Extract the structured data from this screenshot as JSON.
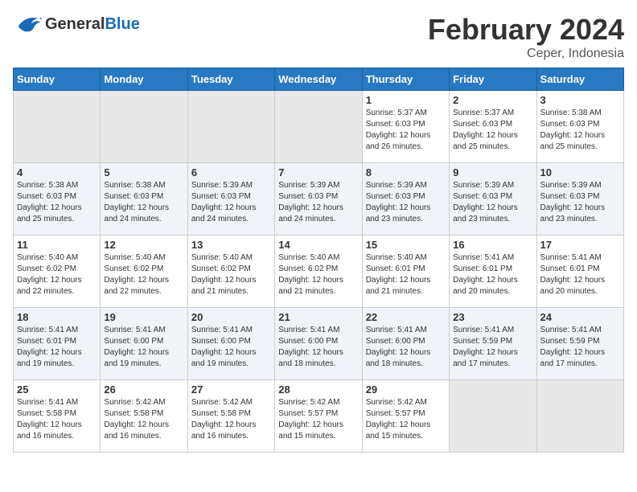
{
  "header": {
    "logo_general": "General",
    "logo_blue": "Blue",
    "month_title": "February 2024",
    "subtitle": "Ceper, Indonesia"
  },
  "weekdays": [
    "Sunday",
    "Monday",
    "Tuesday",
    "Wednesday",
    "Thursday",
    "Friday",
    "Saturday"
  ],
  "weeks": [
    [
      {
        "day": "",
        "sunrise": "",
        "sunset": "",
        "daylight": "",
        "empty": true
      },
      {
        "day": "",
        "sunrise": "",
        "sunset": "",
        "daylight": "",
        "empty": true
      },
      {
        "day": "",
        "sunrise": "",
        "sunset": "",
        "daylight": "",
        "empty": true
      },
      {
        "day": "",
        "sunrise": "",
        "sunset": "",
        "daylight": "",
        "empty": true
      },
      {
        "day": "1",
        "sunrise": "5:37 AM",
        "sunset": "6:03 PM",
        "daylight": "12 hours and 26 minutes."
      },
      {
        "day": "2",
        "sunrise": "5:37 AM",
        "sunset": "6:03 PM",
        "daylight": "12 hours and 25 minutes."
      },
      {
        "day": "3",
        "sunrise": "5:38 AM",
        "sunset": "6:03 PM",
        "daylight": "12 hours and 25 minutes."
      }
    ],
    [
      {
        "day": "4",
        "sunrise": "5:38 AM",
        "sunset": "6:03 PM",
        "daylight": "12 hours and 25 minutes."
      },
      {
        "day": "5",
        "sunrise": "5:38 AM",
        "sunset": "6:03 PM",
        "daylight": "12 hours and 24 minutes."
      },
      {
        "day": "6",
        "sunrise": "5:39 AM",
        "sunset": "6:03 PM",
        "daylight": "12 hours and 24 minutes."
      },
      {
        "day": "7",
        "sunrise": "5:39 AM",
        "sunset": "6:03 PM",
        "daylight": "12 hours and 24 minutes."
      },
      {
        "day": "8",
        "sunrise": "5:39 AM",
        "sunset": "6:03 PM",
        "daylight": "12 hours and 23 minutes."
      },
      {
        "day": "9",
        "sunrise": "5:39 AM",
        "sunset": "6:03 PM",
        "daylight": "12 hours and 23 minutes."
      },
      {
        "day": "10",
        "sunrise": "5:39 AM",
        "sunset": "6:03 PM",
        "daylight": "12 hours and 23 minutes."
      }
    ],
    [
      {
        "day": "11",
        "sunrise": "5:40 AM",
        "sunset": "6:02 PM",
        "daylight": "12 hours and 22 minutes."
      },
      {
        "day": "12",
        "sunrise": "5:40 AM",
        "sunset": "6:02 PM",
        "daylight": "12 hours and 22 minutes."
      },
      {
        "day": "13",
        "sunrise": "5:40 AM",
        "sunset": "6:02 PM",
        "daylight": "12 hours and 21 minutes."
      },
      {
        "day": "14",
        "sunrise": "5:40 AM",
        "sunset": "6:02 PM",
        "daylight": "12 hours and 21 minutes."
      },
      {
        "day": "15",
        "sunrise": "5:40 AM",
        "sunset": "6:01 PM",
        "daylight": "12 hours and 21 minutes."
      },
      {
        "day": "16",
        "sunrise": "5:41 AM",
        "sunset": "6:01 PM",
        "daylight": "12 hours and 20 minutes."
      },
      {
        "day": "17",
        "sunrise": "5:41 AM",
        "sunset": "6:01 PM",
        "daylight": "12 hours and 20 minutes."
      }
    ],
    [
      {
        "day": "18",
        "sunrise": "5:41 AM",
        "sunset": "6:01 PM",
        "daylight": "12 hours and 19 minutes."
      },
      {
        "day": "19",
        "sunrise": "5:41 AM",
        "sunset": "6:00 PM",
        "daylight": "12 hours and 19 minutes."
      },
      {
        "day": "20",
        "sunrise": "5:41 AM",
        "sunset": "6:00 PM",
        "daylight": "12 hours and 19 minutes."
      },
      {
        "day": "21",
        "sunrise": "5:41 AM",
        "sunset": "6:00 PM",
        "daylight": "12 hours and 18 minutes."
      },
      {
        "day": "22",
        "sunrise": "5:41 AM",
        "sunset": "6:00 PM",
        "daylight": "12 hours and 18 minutes."
      },
      {
        "day": "23",
        "sunrise": "5:41 AM",
        "sunset": "5:59 PM",
        "daylight": "12 hours and 17 minutes."
      },
      {
        "day": "24",
        "sunrise": "5:41 AM",
        "sunset": "5:59 PM",
        "daylight": "12 hours and 17 minutes."
      }
    ],
    [
      {
        "day": "25",
        "sunrise": "5:41 AM",
        "sunset": "5:58 PM",
        "daylight": "12 hours and 16 minutes."
      },
      {
        "day": "26",
        "sunrise": "5:42 AM",
        "sunset": "5:58 PM",
        "daylight": "12 hours and 16 minutes."
      },
      {
        "day": "27",
        "sunrise": "5:42 AM",
        "sunset": "5:58 PM",
        "daylight": "12 hours and 16 minutes."
      },
      {
        "day": "28",
        "sunrise": "5:42 AM",
        "sunset": "5:57 PM",
        "daylight": "12 hours and 15 minutes."
      },
      {
        "day": "29",
        "sunrise": "5:42 AM",
        "sunset": "5:57 PM",
        "daylight": "12 hours and 15 minutes."
      },
      {
        "day": "",
        "sunrise": "",
        "sunset": "",
        "daylight": "",
        "empty": true
      },
      {
        "day": "",
        "sunrise": "",
        "sunset": "",
        "daylight": "",
        "empty": true
      }
    ]
  ]
}
